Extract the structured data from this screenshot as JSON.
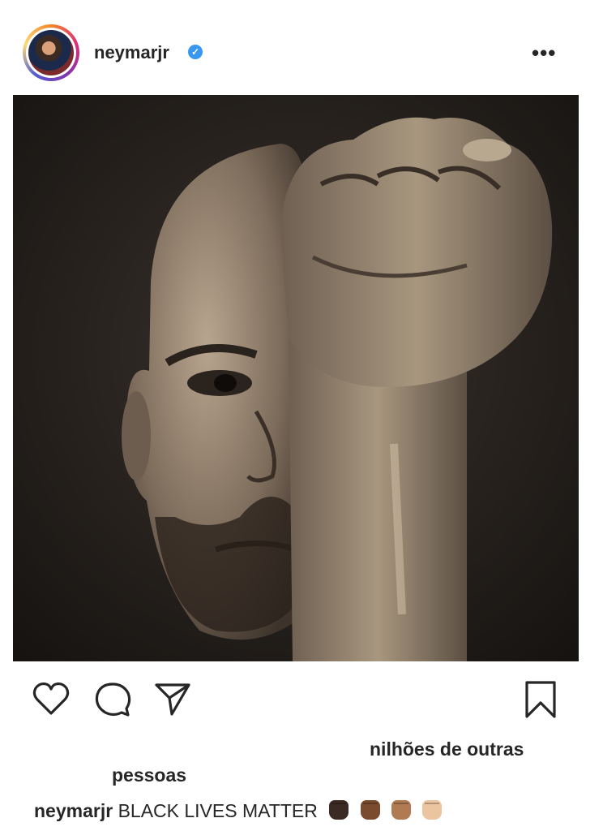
{
  "post": {
    "username": "neymarjr",
    "verified_icon": "verified-badge-icon",
    "more_label": "•••",
    "image_alt": "Black and white portrait of a man with a raised fist in front of his face",
    "likes_line1": "nilhões de outras",
    "likes_line2": "pessoas",
    "caption_user": "neymarjr",
    "caption_text": "BLACK LIVES MATTER",
    "caption_emojis": [
      "raised-fist-dark-icon",
      "raised-fist-medium-dark-icon",
      "raised-fist-medium-icon",
      "raised-fist-light-icon"
    ]
  },
  "colors": {
    "verified": "#3897f0",
    "text": "#262626",
    "fist_tones": [
      "#3b2a24",
      "#7a4b2e",
      "#b07a52",
      "#ebc4a0"
    ]
  },
  "actions": {
    "like_icon": "heart-icon",
    "comment_icon": "comment-icon",
    "share_icon": "paper-plane-icon",
    "save_icon": "bookmark-icon"
  }
}
